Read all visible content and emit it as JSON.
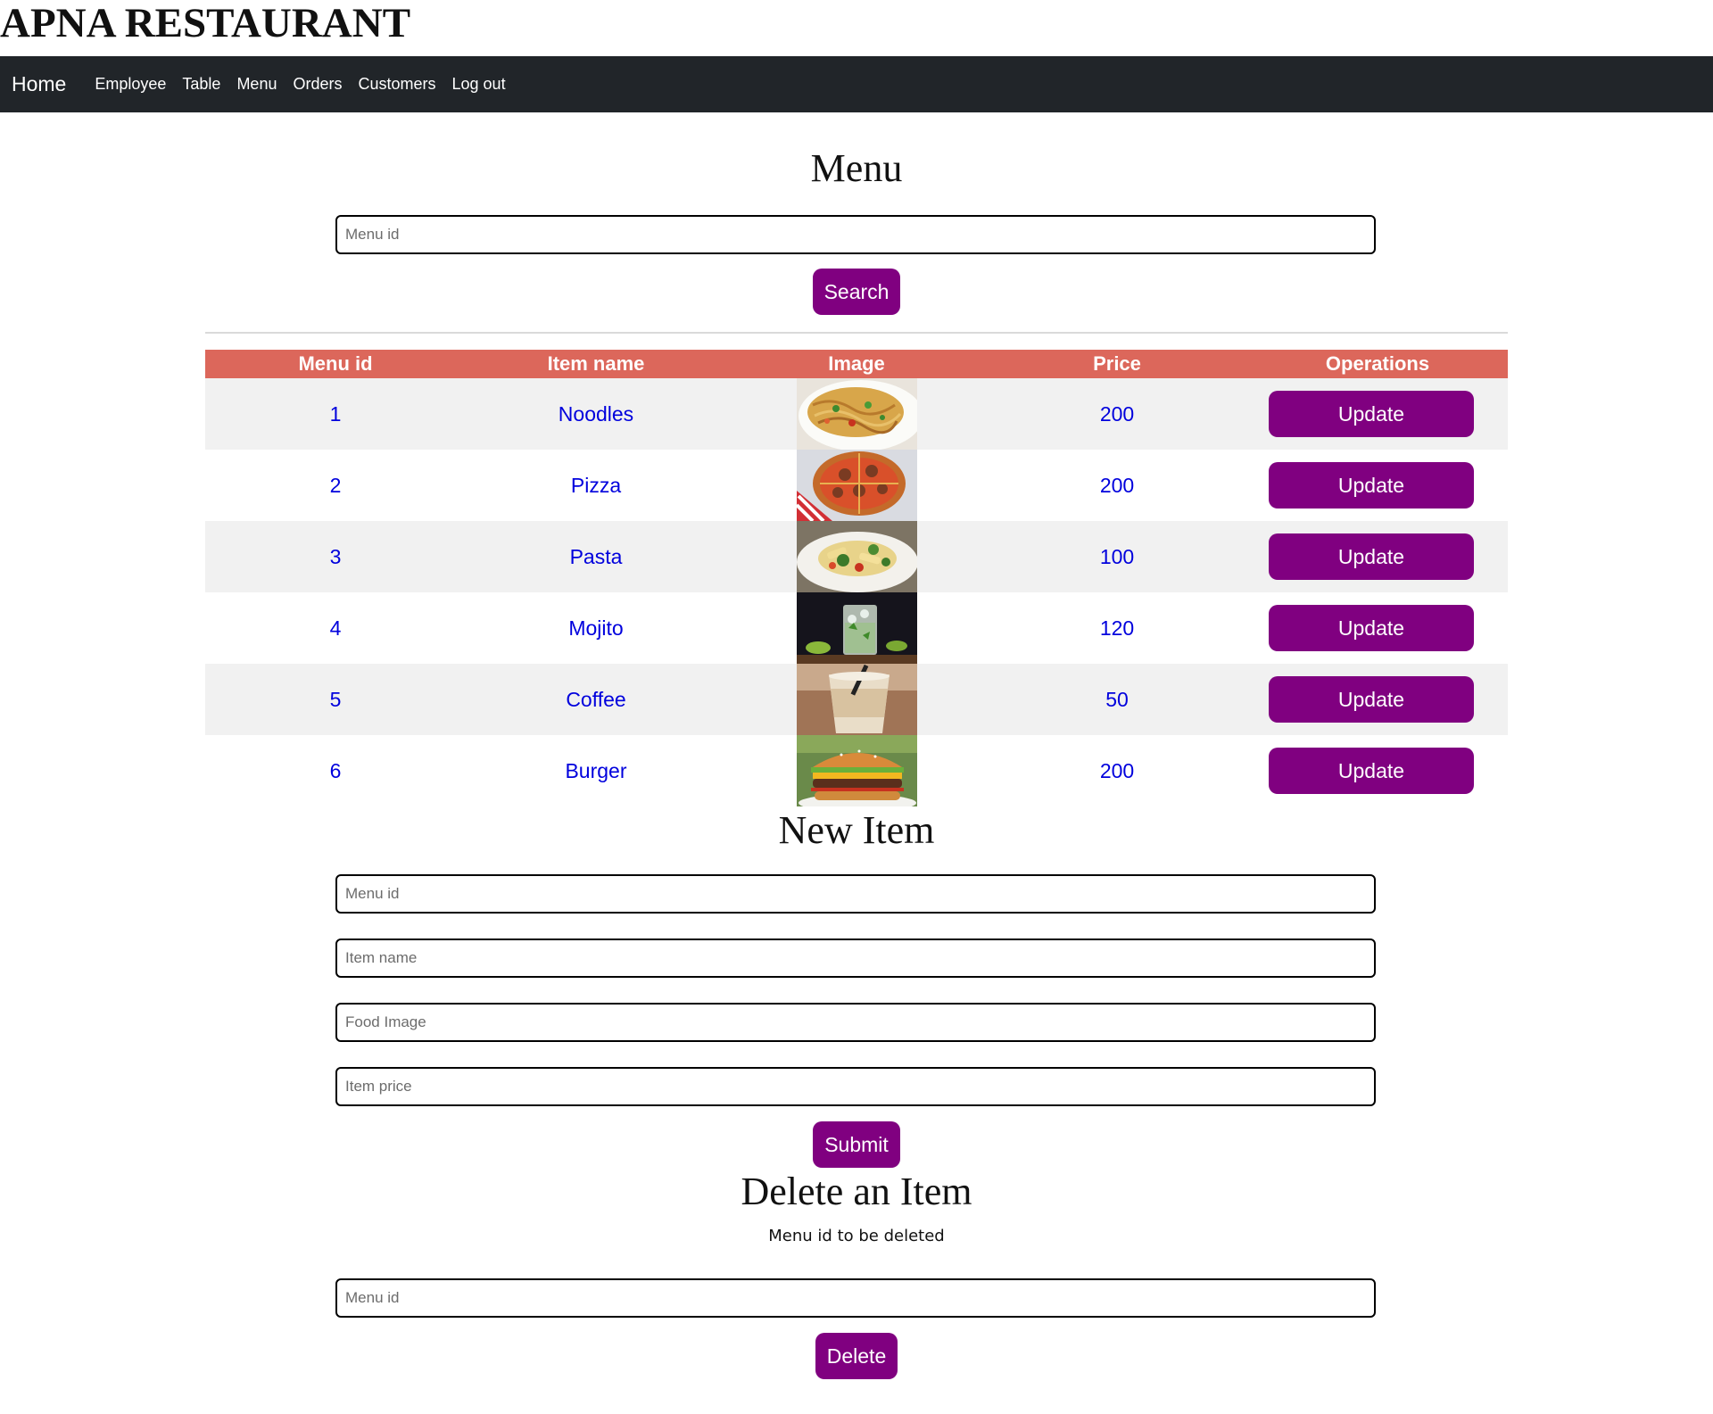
{
  "app": {
    "title": "APNA RESTAURANT"
  },
  "nav": {
    "home": "Home",
    "links": [
      "Employee",
      "Table",
      "Menu",
      "Orders",
      "Customers",
      "Log out"
    ]
  },
  "menu_section": {
    "title": "Menu",
    "search_placeholder": "Menu id",
    "search_label": "Search"
  },
  "table": {
    "columns": [
      "Menu id",
      "Item name",
      "Image",
      "Price",
      "Operations"
    ],
    "update_label": "Update",
    "rows": [
      {
        "id": "1",
        "name": "Noodles",
        "image": "noodles-photo",
        "price": "200"
      },
      {
        "id": "2",
        "name": "Pizza",
        "image": "pizza-photo",
        "price": "200"
      },
      {
        "id": "3",
        "name": "Pasta",
        "image": "pasta-photo",
        "price": "100"
      },
      {
        "id": "4",
        "name": "Mojito",
        "image": "mojito-photo",
        "price": "120"
      },
      {
        "id": "5",
        "name": "Coffee",
        "image": "coffee-photo",
        "price": "50"
      },
      {
        "id": "6",
        "name": "Burger",
        "image": "burger-photo",
        "price": "200"
      }
    ]
  },
  "new_item": {
    "title": "New Item",
    "fields": [
      "Menu id",
      "Item name",
      "Food Image",
      "Item price"
    ],
    "submit_label": "Submit"
  },
  "delete_item": {
    "title": "Delete an Item",
    "instruction": "Menu id to be deleted",
    "placeholder": "Menu id",
    "delete_label": "Delete"
  },
  "colors": {
    "navbar": "#212529",
    "button": "#800080",
    "table_header": "#dc675b",
    "link_text": "#0000dd",
    "row_stripe": "#f1f1f1"
  }
}
